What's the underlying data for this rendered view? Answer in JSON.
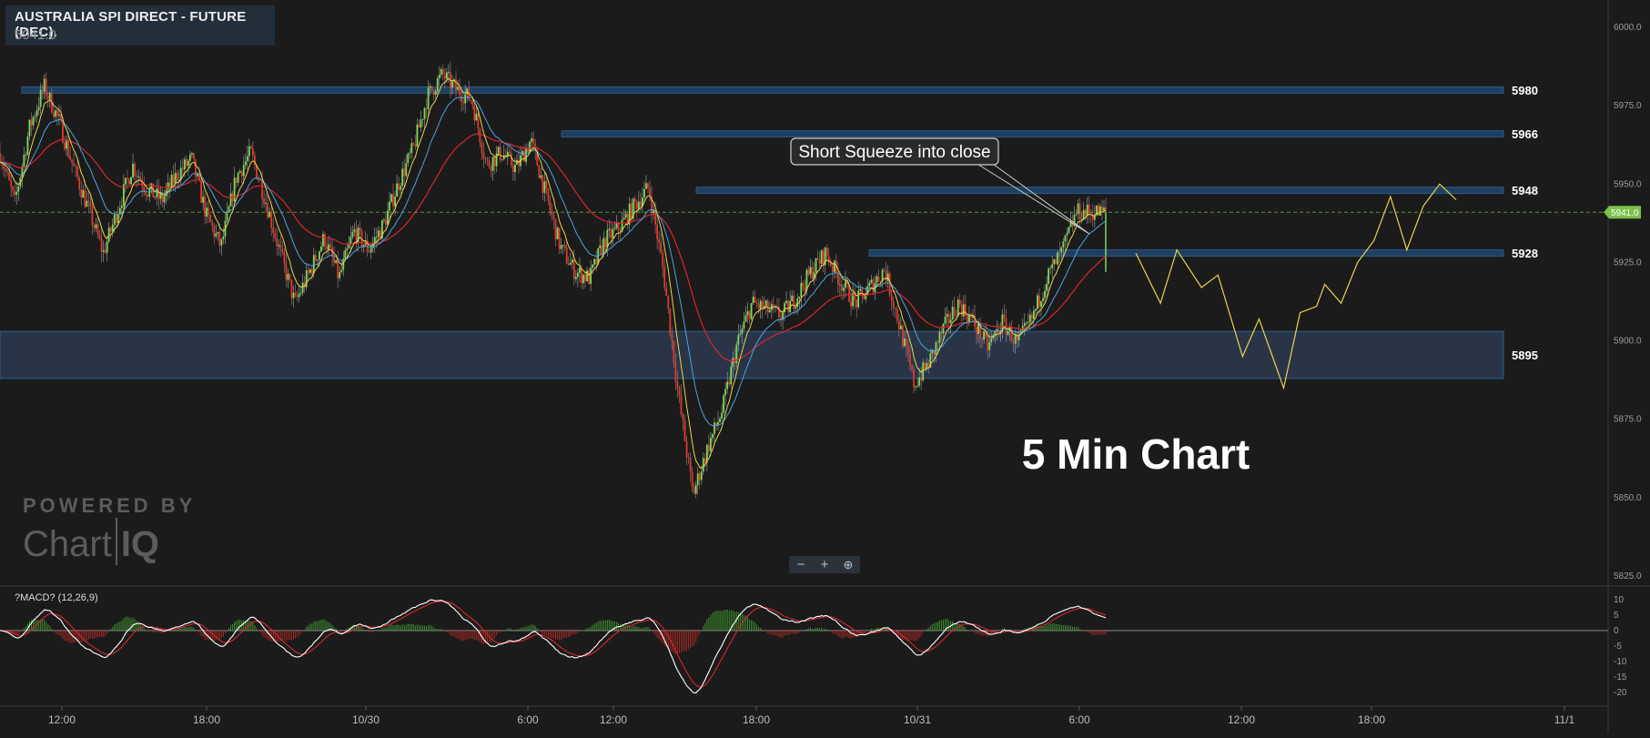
{
  "title": {
    "name": "AUSTRALIA SPI DIRECT - FUTURE (DEC).",
    "price": "5941.0"
  },
  "annotation": {
    "callout": "Short Squeeze into close",
    "big_label": "5 Min Chart"
  },
  "logo": {
    "line1": "POWERED BY",
    "word1": "Chart",
    "word2": "IQ"
  },
  "zoom": {
    "minus": "−",
    "plus": "+",
    "magnify": "⊕"
  },
  "colors": {
    "background": "#1b1b1b",
    "level_band": "#1f4b78",
    "zone_fill": "#2c3a4f",
    "up_candle": "#7ed957",
    "down_candle": "#e0392b",
    "ma_fast": "#e5d44f",
    "ma_mid": "#4aa3df",
    "ma_slow": "#d8262f",
    "projection": "#e5d44f",
    "macd_line": "#ffffff",
    "signal_line": "#d8262f",
    "current_price": "#7cc04a"
  },
  "chart_data": [
    {
      "type": "candlestick",
      "title": "AUSTRALIA SPI DIRECT - FUTURE (DEC).",
      "timeframe": "5 Min",
      "x_ticks": [
        "12:00",
        "18:00",
        "10/30",
        "6:00",
        "12:00",
        "18:00",
        "10/31",
        "6:00",
        "12:00",
        "18:00",
        "11/1"
      ],
      "y_ticks": [
        "6000.0",
        "5975.0",
        "5950.0",
        "5925.0",
        "5900.0",
        "5875.0",
        "5850.0",
        "5825.0"
      ],
      "ylim": [
        5825,
        6000
      ],
      "current_price": 5941.0,
      "current_price_label": "5941.0",
      "levels": [
        {
          "label": "5980",
          "value": 5980
        },
        {
          "label": "5966",
          "value": 5966
        },
        {
          "label": "5948",
          "value": 5948
        },
        {
          "label": "5928",
          "value": 5928
        }
      ],
      "zone": {
        "label": "5895",
        "low": 5888,
        "high": 5903
      },
      "series": [
        {
          "kind": "price_path",
          "t": [
            0,
            2,
            4,
            6,
            8,
            10,
            12,
            14,
            16,
            18,
            20,
            22,
            24,
            26,
            28,
            30,
            32,
            34,
            36,
            38,
            40,
            42,
            44,
            46,
            48,
            50,
            52,
            54,
            56,
            58,
            60,
            62,
            64,
            66,
            68,
            70,
            72,
            74,
            76,
            78,
            80,
            82,
            84,
            86,
            88,
            90,
            92,
            94,
            96,
            98,
            100,
            102,
            104,
            106,
            108,
            110,
            112,
            114,
            116,
            118,
            120,
            122,
            124,
            126,
            128,
            130,
            132,
            134,
            136,
            138,
            140,
            142,
            144,
            146,
            148,
            150,
            152,
            154,
            156,
            158,
            160,
            162,
            164,
            166,
            168,
            170,
            172,
            174,
            176,
            178,
            180,
            182,
            184,
            186,
            188,
            190,
            192,
            194,
            196,
            198,
            200
          ],
          "values": [
            5960,
            5944,
            5968,
            5981,
            5970,
            5955,
            5942,
            5928,
            5942,
            5956,
            5948,
            5945,
            5953,
            5958,
            5940,
            5930,
            5952,
            5960,
            5945,
            5928,
            5912,
            5922,
            5933,
            5920,
            5935,
            5929,
            5937,
            5950,
            5961,
            5978,
            5985,
            5980,
            5977,
            5956,
            5960,
            5955,
            5964,
            5947,
            5930,
            5922,
            5920,
            5932,
            5936,
            5943,
            5949,
            5922,
            5883,
            5851,
            5866,
            5878,
            5899,
            5912,
            5910,
            5908,
            5914,
            5922,
            5928,
            5919,
            5912,
            5917,
            5923,
            5905,
            5886,
            5893,
            5904,
            5912,
            5906,
            5898,
            5906,
            5899,
            5907,
            5920,
            5928,
            5941,
            5941,
            5941,
            5941,
            5941,
            5941,
            5941,
            5941,
            5941,
            5941,
            5941,
            5941,
            5941,
            5941,
            5941,
            5941,
            5941,
            5941,
            5941,
            5941,
            5941,
            5941,
            5941,
            5941,
            5941,
            5941,
            5941,
            5941
          ]
        }
      ],
      "projection": {
        "t": [
          150,
          153,
          155,
          158,
          160,
          163,
          165,
          168,
          170,
          172,
          173,
          175,
          177,
          179,
          181,
          183,
          185,
          187,
          189
        ],
        "values": [
          5928,
          5912,
          5929,
          5917,
          5921,
          5895,
          5907,
          5885,
          5909,
          5911,
          5918,
          5912,
          5925,
          5932,
          5946,
          5929,
          5943,
          5950,
          5945
        ]
      }
    },
    {
      "type": "line",
      "title": "?MACD? (12,26,9)",
      "y_ticks": [
        "10",
        "5",
        "0",
        "-5",
        "-10",
        "-15",
        "-20"
      ],
      "ylim": [
        -22,
        12
      ]
    }
  ]
}
